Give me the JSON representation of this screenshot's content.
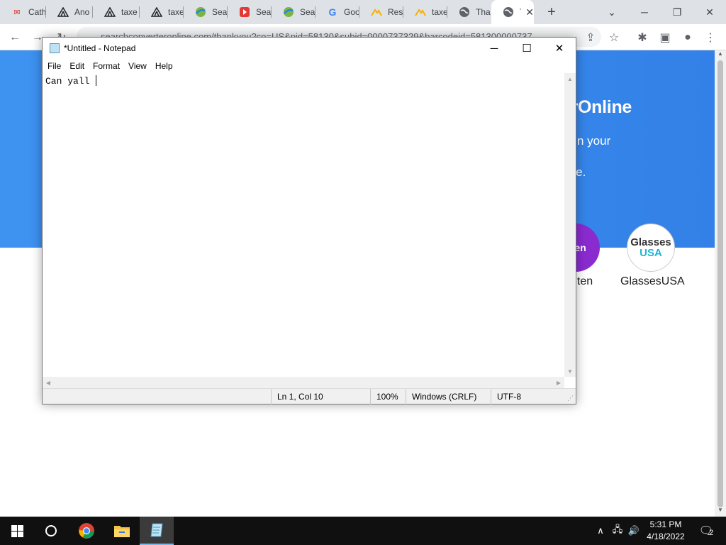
{
  "browser": {
    "tabs": [
      {
        "title": "Cath",
        "favicon": "mail-icon"
      },
      {
        "title": "Ano",
        "favicon": "tent-icon"
      },
      {
        "title": "taxe",
        "favicon": "tent-icon"
      },
      {
        "title": "taxe",
        "favicon": "tent-icon"
      },
      {
        "title": "Sear",
        "favicon": "globe-leaf-icon"
      },
      {
        "title": "Sear",
        "favicon": "play-shield-icon"
      },
      {
        "title": "Sear",
        "favicon": "globe-leaf-icon"
      },
      {
        "title": "Goo",
        "favicon": "google-icon"
      },
      {
        "title": "Resi",
        "favicon": "mountain-icon"
      },
      {
        "title": "taxe",
        "favicon": "mountain-icon"
      },
      {
        "title": "Tha",
        "favicon": "globe-icon"
      },
      {
        "title": "T",
        "favicon": "globe-icon",
        "active": true
      }
    ],
    "url": "searchconverteronline.com/thankyou?co=US&pid=58130&subid=0000737329&barcodeid=581300000737"
  },
  "page": {
    "brand_partial": "erOnline",
    "line1_partial": "s in your",
    "line2_partial": "ore.",
    "rakuten_logo_text": "uten",
    "rakuten_caption": "uten",
    "glasses_logo_line1": "Glasses",
    "glasses_logo_line2": "USA",
    "glasses_caption": "GlassesUSA",
    "hero_color": "#3e92f0"
  },
  "notepad": {
    "title": "*Untitled - Notepad",
    "menu": [
      "File",
      "Edit",
      "Format",
      "View",
      "Help"
    ],
    "content": "Can yall ",
    "status": {
      "position": "Ln 1, Col 10",
      "zoom": "100%",
      "line_ending": "Windows (CRLF)",
      "encoding": "UTF-8"
    }
  },
  "taskbar": {
    "time": "5:31 PM",
    "date": "4/18/2022",
    "notification_count": "2"
  }
}
